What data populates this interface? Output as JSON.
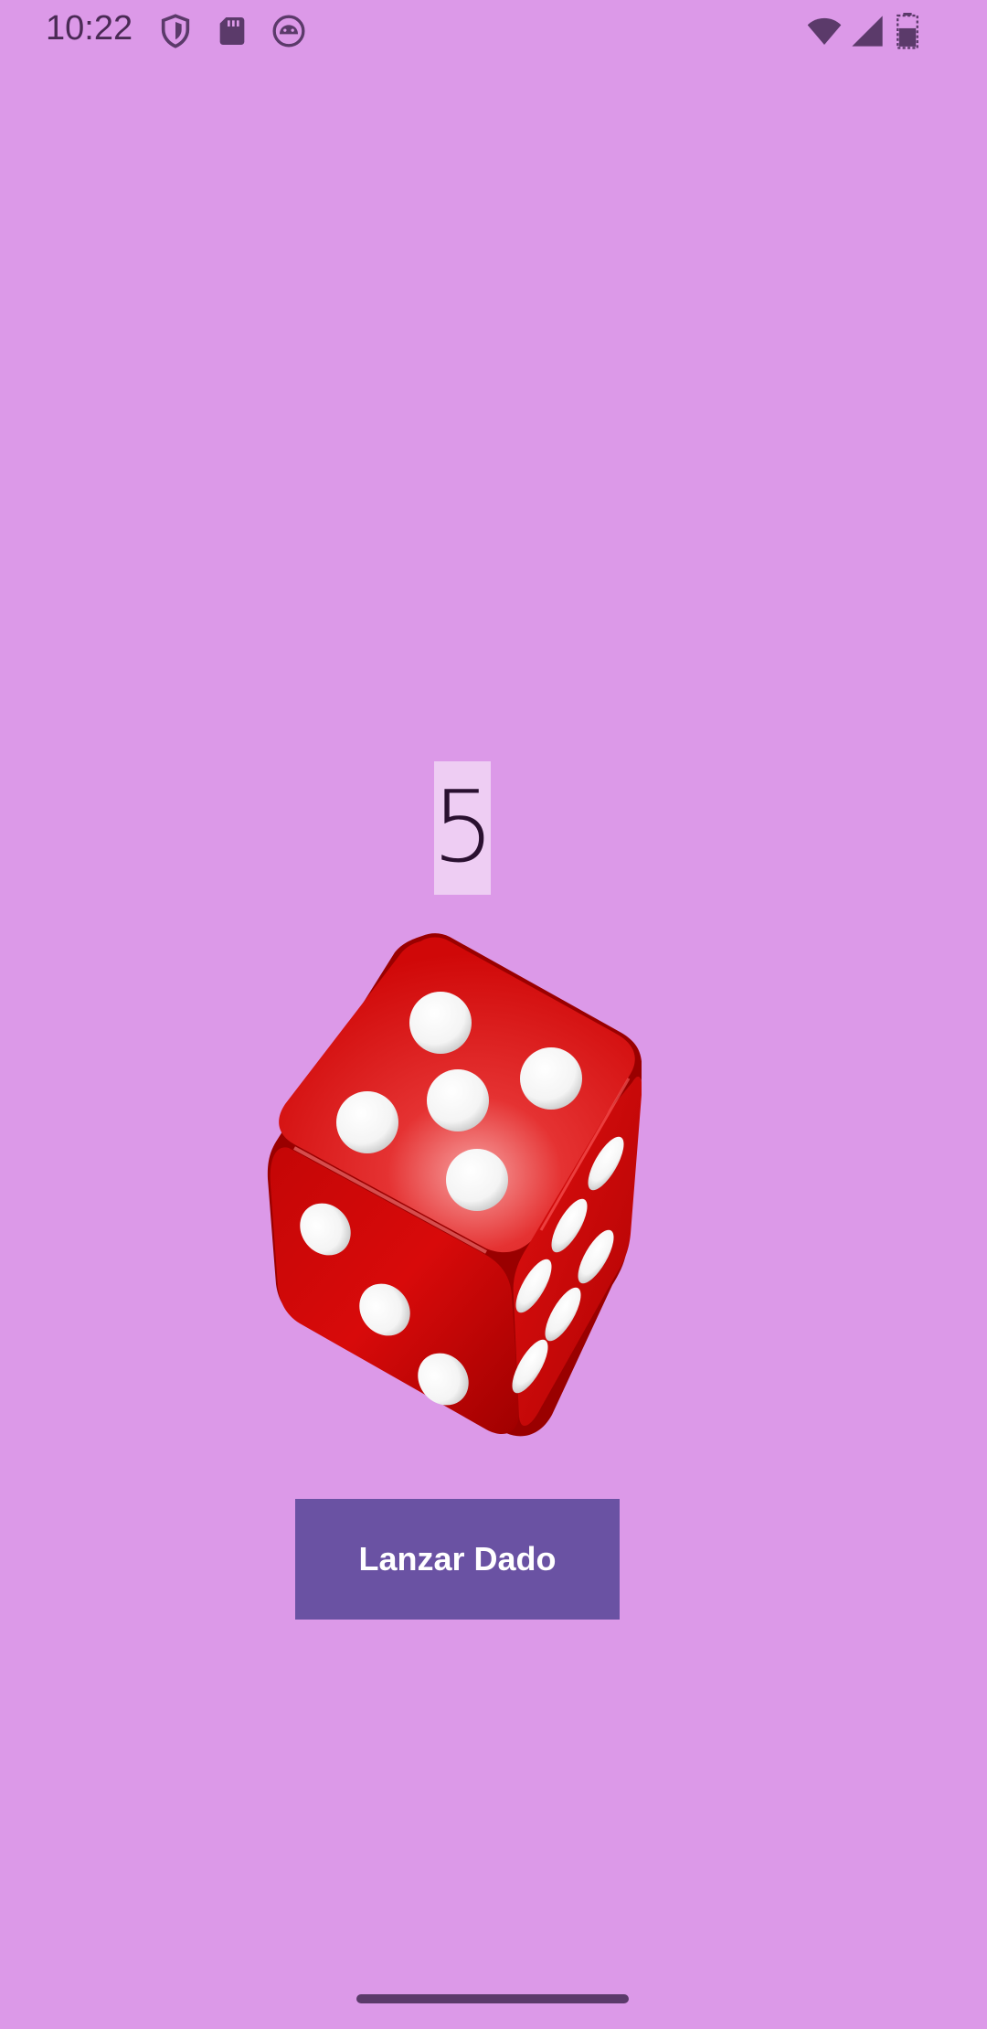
{
  "status_bar": {
    "time": "10:22",
    "icons": [
      "shield-icon",
      "sd-card-icon",
      "android-face-icon",
      "wifi-icon",
      "signal-icon",
      "battery-icon"
    ]
  },
  "main": {
    "result": "5",
    "dice_value": 5,
    "roll_button_label": "Lanzar Dado"
  },
  "colors": {
    "background": "#dc99e8",
    "result_box": "#eecdf3",
    "button": "#6a52a3",
    "dice": "#d80a0a"
  }
}
